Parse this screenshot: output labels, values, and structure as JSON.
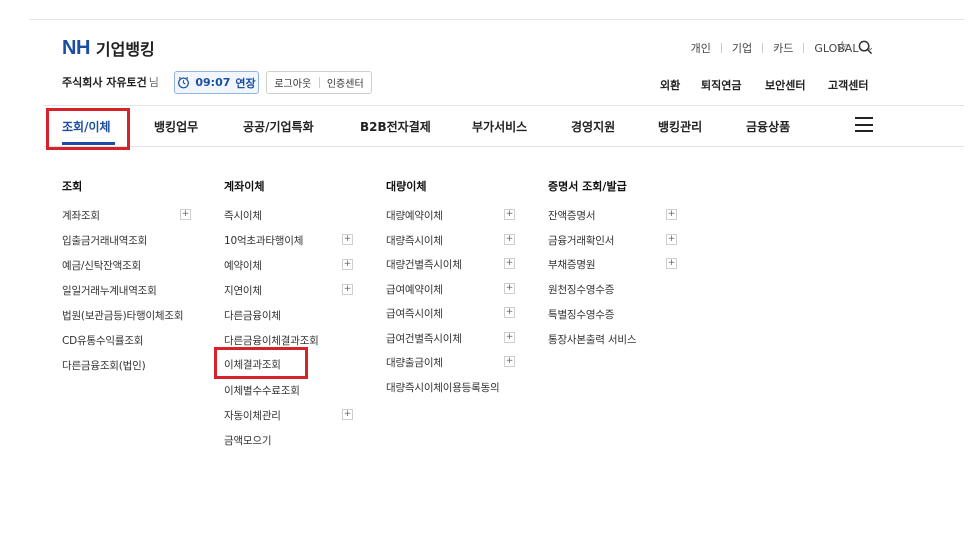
{
  "brand": {
    "logo_nh": "NH",
    "logo_name": "기업뱅킹"
  },
  "utility_nav": {
    "items": [
      "개인",
      "기업",
      "카드",
      "GLOBAL"
    ]
  },
  "user": {
    "name": "주식회사 자유토건",
    "suffix": "님"
  },
  "session": {
    "timer_value": "09:07",
    "extend_label": "연장"
  },
  "auth_buttons": {
    "logout": "로그아웃",
    "cert_center": "인증센터"
  },
  "quick_links": [
    "외환",
    "퇴직연금",
    "보안센터",
    "고객센터"
  ],
  "gnb": {
    "items": [
      "조회/이체",
      "뱅킹업무",
      "공공/기업특화",
      "B2B전자결제",
      "부가서비스",
      "경영지원",
      "뱅킹관리",
      "금융상품"
    ],
    "active_index": 0
  },
  "mega_menu": {
    "columns": [
      {
        "title": "조회",
        "items": [
          {
            "label": "계좌조회",
            "expandable": true
          },
          {
            "label": "입출금거래내역조회",
            "expandable": false
          },
          {
            "label": "예금/신탁잔액조회",
            "expandable": false
          },
          {
            "label": "일일거래누계내역조회",
            "expandable": false
          },
          {
            "label": "법원(보관금등)타행이체조회",
            "expandable": false
          },
          {
            "label": "CD유통수익률조회",
            "expandable": false
          },
          {
            "label": "다른금융조회(법인)",
            "expandable": false
          }
        ]
      },
      {
        "title": "계좌이체",
        "items": [
          {
            "label": "즉시이체",
            "expandable": false
          },
          {
            "label": "10억초과타행이체",
            "expandable": true
          },
          {
            "label": "예약이체",
            "expandable": true
          },
          {
            "label": "지연이체",
            "expandable": true
          },
          {
            "label": "다른금융이체",
            "expandable": false
          },
          {
            "label": "다른금융이체결과조회",
            "expandable": false
          },
          {
            "label": "이체결과조회",
            "expandable": false
          },
          {
            "label": "이체별수수료조회",
            "expandable": false
          },
          {
            "label": "자동이체관리",
            "expandable": true
          },
          {
            "label": "금액모으기",
            "expandable": false
          }
        ]
      },
      {
        "title": "대량이체",
        "items": [
          {
            "label": "대량예약이체",
            "expandable": true
          },
          {
            "label": "대량즉시이체",
            "expandable": true
          },
          {
            "label": "대량건별즉시이체",
            "expandable": true
          },
          {
            "label": "급여예약이체",
            "expandable": true
          },
          {
            "label": "급여즉시이체",
            "expandable": true
          },
          {
            "label": "급여건별즉시이체",
            "expandable": true
          },
          {
            "label": "대량출금이체",
            "expandable": true
          },
          {
            "label": "대량즉시이체이용등록동의",
            "expandable": false
          }
        ]
      },
      {
        "title": "증명서 조회/발급",
        "items": [
          {
            "label": "잔액증명서",
            "expandable": true
          },
          {
            "label": "금융거래확인서",
            "expandable": true
          },
          {
            "label": "부채증명원",
            "expandable": true
          },
          {
            "label": "원천징수영수증",
            "expandable": false
          },
          {
            "label": "특별징수영수증",
            "expandable": false
          },
          {
            "label": "통장사본출력 서비스",
            "expandable": false
          }
        ]
      }
    ]
  },
  "highlight_color": "#d7222a",
  "accent_color": "#1a4ea2",
  "icons": [
    "clock-icon",
    "star-icon",
    "search-icon",
    "chevron-down-icon",
    "menu-icon",
    "plus-icon"
  ]
}
